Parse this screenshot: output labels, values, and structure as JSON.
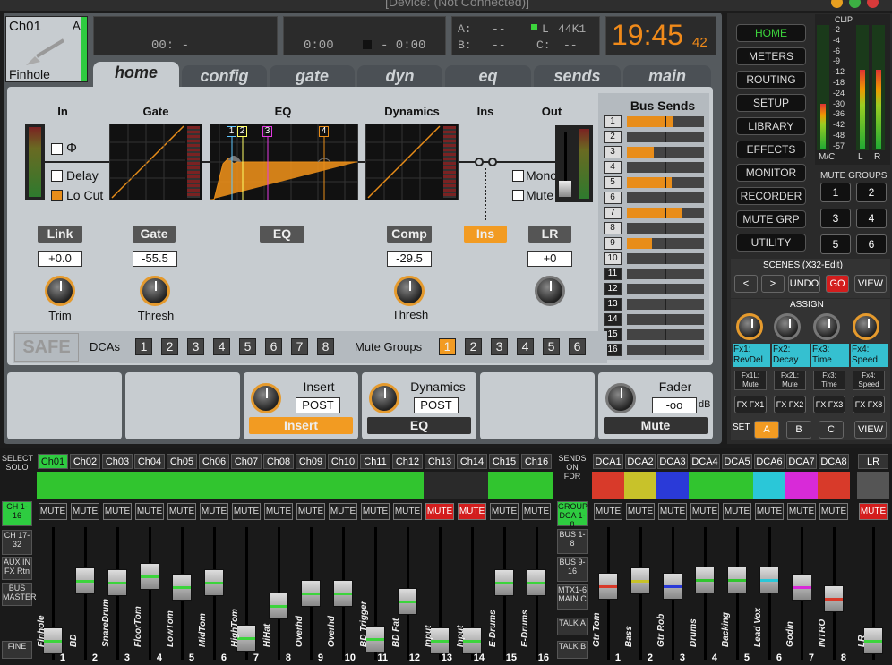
{
  "title_bar": {
    "text": "[Device: (Not Connected)]"
  },
  "header": {
    "channel": "Ch01",
    "channel_tag": "A",
    "instrument": "Finhole",
    "time_display1": "00: -",
    "counter_left": "0:00",
    "counter_right": "- 0:00",
    "status_a": "A:",
    "status_a_val": "--",
    "status_b": "B:",
    "status_b_val": "--",
    "status_l": "L",
    "status_l_val": "44K1",
    "status_c": "C:",
    "status_c_val": "--",
    "clock": "19:45",
    "clock_sec": "42"
  },
  "tabs": [
    {
      "label": "home"
    },
    {
      "label": "config"
    },
    {
      "label": "gate"
    },
    {
      "label": "dyn"
    },
    {
      "label": "eq"
    },
    {
      "label": "sends"
    },
    {
      "label": "main"
    }
  ],
  "home": {
    "sections": {
      "in": "In",
      "gate": "Gate",
      "eq": "EQ",
      "dynamics": "Dynamics",
      "ins": "Ins",
      "out": "Out"
    },
    "in_options": {
      "phase": "Φ",
      "delay": "Delay",
      "locut": "Lo Cut"
    },
    "out_options": {
      "mono": "Mono",
      "mute": "Mute"
    },
    "eq_bands": [
      "1",
      "2",
      "3",
      "4"
    ],
    "buttons": {
      "link": "Link",
      "gate": "Gate",
      "eq": "EQ",
      "comp": "Comp",
      "ins": "Ins",
      "lr": "LR"
    },
    "values": {
      "trim": "+0.0",
      "gate": "-55.5",
      "comp": "-29.5",
      "lr": "+0"
    },
    "knob_labels": {
      "trim": "Trim",
      "gate": "Thresh",
      "comp": "Thresh"
    },
    "safe": "SAFE",
    "dcas_label": "DCAs",
    "dcas": [
      "1",
      "2",
      "3",
      "4",
      "5",
      "6",
      "7",
      "8"
    ],
    "mute_groups_label": "Mute Groups",
    "mute_groups": [
      "1",
      "2",
      "3",
      "4",
      "5",
      "6"
    ],
    "bus_sends_title": "Bus Sends",
    "bus_sends": [
      {
        "n": "1",
        "level": 0.6
      },
      {
        "n": "2",
        "level": 0
      },
      {
        "n": "3",
        "level": 0.35
      },
      {
        "n": "4",
        "level": 0
      },
      {
        "n": "5",
        "level": 0.58
      },
      {
        "n": "6",
        "level": 0
      },
      {
        "n": "7",
        "level": 0.72
      },
      {
        "n": "8",
        "level": 0
      },
      {
        "n": "9",
        "level": 0.32
      },
      {
        "n": "10",
        "level": 0
      },
      {
        "n": "11",
        "level": 0
      },
      {
        "n": "12",
        "level": 0
      },
      {
        "n": "13",
        "level": 0
      },
      {
        "n": "14",
        "level": 0
      },
      {
        "n": "15",
        "level": 0
      },
      {
        "n": "16",
        "level": 0
      }
    ]
  },
  "lower": {
    "insert_label": "Insert",
    "insert_mode": "POST",
    "insert_btn": "Insert",
    "dynamics_label": "Dynamics",
    "dynamics_mode": "POST",
    "eq_btn": "EQ",
    "fader_label": "Fader",
    "fader_value": "-oo",
    "fader_unit": "dB",
    "mute_btn": "Mute"
  },
  "right_nav": [
    "HOME",
    "METERS",
    "ROUTING",
    "SETUP",
    "LIBRARY",
    "EFFECTS",
    "MONITOR",
    "RECORDER",
    "MUTE GRP",
    "UTILITY"
  ],
  "meters": {
    "clip": "CLIP",
    "scale": [
      "-2",
      "-4",
      "-6",
      "-9",
      "-12",
      "-18",
      "-24",
      "-30",
      "-36",
      "-42",
      "-48",
      "-57"
    ],
    "mc": "M/C",
    "l": "L",
    "r": "R"
  },
  "mute_groups_panel": {
    "title": "MUTE GROUPS",
    "buttons": [
      "1",
      "2",
      "3",
      "4",
      "5",
      "6"
    ]
  },
  "scenes": {
    "title": "SCENES (X32-Edit)",
    "prev": "<",
    "next": ">",
    "undo": "UNDO",
    "go": "GO",
    "view": "VIEW"
  },
  "assign": {
    "title": "ASSIGN",
    "fx": [
      "Fx1: RevDel",
      "Fx2: Decay",
      "Fx3: Time",
      "Fx4: Speed"
    ],
    "fx_small": [
      "Fx1L: Mute",
      "Fx2L: Mute",
      "Fx3: Time",
      "Fx4: Speed"
    ],
    "fx_row": [
      "FX FX1",
      "FX FX2",
      "FX FX3",
      "FX FX8"
    ],
    "set": "SET",
    "sets": [
      "A",
      "B",
      "C"
    ],
    "view": "VIEW"
  },
  "left_buttons": {
    "select_solo": "SELECT SOLO",
    "ch_1_16": "CH 1-16",
    "ch_17_32": "CH 17-32",
    "aux": "AUX IN FX Rtn",
    "bus_master": "BUS MASTER",
    "fine": "FINE"
  },
  "mid_buttons": {
    "sends": "SENDS ON FDR",
    "group": "GROUP DCA 1-8",
    "bus1": "BUS 1-8",
    "bus2": "BUS 9-16",
    "mtx": "MTX1-6 MAIN C",
    "talka": "TALK A",
    "talkb": "TALK B"
  },
  "channels": [
    {
      "name": "Ch01",
      "label": "Finhole",
      "num": "1",
      "mute": "MUTE",
      "muted": false,
      "fader": 0.05,
      "color": "#31c52f",
      "icon": "guitar-icon"
    },
    {
      "name": "Ch02",
      "label": "BD",
      "num": "2",
      "mute": "MUTE",
      "muted": false,
      "fader": 0.62,
      "color": "#31c52f",
      "icon": "drum-icon"
    },
    {
      "name": "Ch03",
      "label": "SnareDrum",
      "num": "3",
      "mute": "MUTE",
      "muted": false,
      "fader": 0.6,
      "color": "#31c52f",
      "icon": "drum-icon"
    },
    {
      "name": "Ch04",
      "label": "FloorTom",
      "num": "4",
      "mute": "MUTE",
      "muted": false,
      "fader": 0.66,
      "color": "#31c52f",
      "icon": "drum-icon"
    },
    {
      "name": "Ch05",
      "label": "LowTom",
      "num": "5",
      "mute": "MUTE",
      "muted": false,
      "fader": 0.56,
      "color": "#31c52f",
      "icon": "drum-icon"
    },
    {
      "name": "Ch06",
      "label": "MidTom",
      "num": "6",
      "mute": "MUTE",
      "muted": false,
      "fader": 0.6,
      "color": "#31c52f",
      "icon": "drum-icon"
    },
    {
      "name": "Ch07",
      "label": "HighTom",
      "num": "7",
      "mute": "MUTE",
      "muted": false,
      "fader": 0.08,
      "color": "#31c52f",
      "icon": "drum-icon"
    },
    {
      "name": "Ch08",
      "label": "HiHat",
      "num": "8",
      "mute": "MUTE",
      "muted": false,
      "fader": 0.38,
      "color": "#31c52f",
      "icon": "cymbal-icon"
    },
    {
      "name": "Ch09",
      "label": "Overhd",
      "num": "9",
      "mute": "MUTE",
      "muted": false,
      "fader": 0.5,
      "color": "#31c52f",
      "icon": "mic-icon"
    },
    {
      "name": "Ch10",
      "label": "Overhd",
      "num": "10",
      "mute": "MUTE",
      "muted": false,
      "fader": 0.5,
      "color": "#31c52f",
      "icon": "mic-icon"
    },
    {
      "name": "Ch11",
      "label": "BD Trigger",
      "num": "11",
      "mute": "MUTE",
      "muted": false,
      "fader": 0.07,
      "color": "#31c52f",
      "icon": "drum-icon"
    },
    {
      "name": "Ch12",
      "label": "BD Fat",
      "num": "12",
      "mute": "MUTE",
      "muted": false,
      "fader": 0.42,
      "color": "#31c52f",
      "icon": "drum-icon"
    },
    {
      "name": "Ch13",
      "label": "Input",
      "num": "13",
      "mute": "MUTE",
      "muted": true,
      "fader": 0.05,
      "color": "#2a2a2a",
      "icon": "xlr-icon"
    },
    {
      "name": "Ch14",
      "label": "Input",
      "num": "14",
      "mute": "MUTE",
      "muted": true,
      "fader": 0.05,
      "color": "#2a2a2a",
      "icon": "xlr-icon"
    },
    {
      "name": "Ch15",
      "label": "E-Drums",
      "num": "15",
      "mute": "MUTE",
      "muted": false,
      "fader": 0.6,
      "color": "#31c52f",
      "icon": "drum-icon"
    },
    {
      "name": "Ch16",
      "label": "E-Drums",
      "num": "16",
      "mute": "MUTE",
      "muted": false,
      "fader": 0.6,
      "color": "#31c52f",
      "icon": "drum-icon"
    }
  ],
  "dcas": [
    {
      "name": "DCA1",
      "label": "Gtr Tom",
      "num": "1",
      "mute": "MUTE",
      "fader": 0.57,
      "color": "#d83a2a"
    },
    {
      "name": "DCA2",
      "label": "Bass",
      "num": "2",
      "mute": "MUTE",
      "fader": 0.62,
      "color": "#c8c22a"
    },
    {
      "name": "DCA3",
      "label": "Gtr Rob",
      "num": "3",
      "mute": "MUTE",
      "fader": 0.57,
      "color": "#2a3ad8"
    },
    {
      "name": "DCA4",
      "label": "Drums",
      "num": "4",
      "mute": "MUTE",
      "fader": 0.63,
      "color": "#31c52f"
    },
    {
      "name": "DCA5",
      "label": "Backing",
      "num": "5",
      "mute": "MUTE",
      "fader": 0.63,
      "color": "#31c52f"
    },
    {
      "name": "DCA6",
      "label": "Lead Vox",
      "num": "6",
      "mute": "MUTE",
      "fader": 0.63,
      "color": "#2ac7d8"
    },
    {
      "name": "DCA7",
      "label": "Godin",
      "num": "7",
      "mute": "MUTE",
      "fader": 0.56,
      "color": "#d82ad8"
    },
    {
      "name": "DCA8",
      "label": "INTRO",
      "num": "8",
      "mute": "MUTE",
      "fader": 0.45,
      "color": "#d83a2a"
    }
  ],
  "lr": {
    "name": "LR",
    "mute": "MUTE",
    "label": "LR",
    "fader": 0.05
  }
}
